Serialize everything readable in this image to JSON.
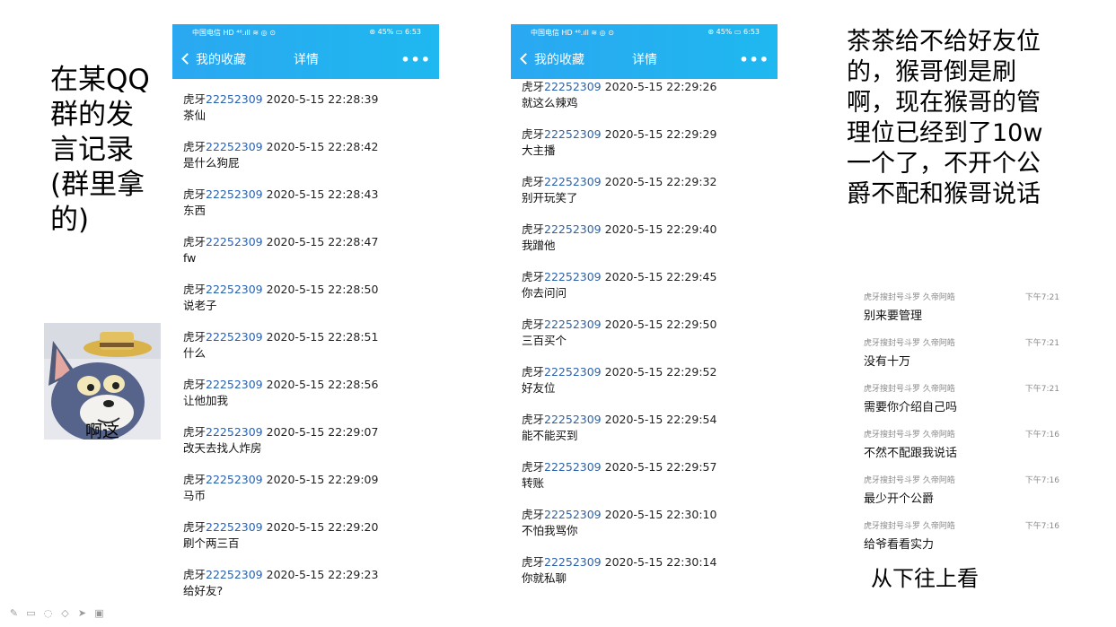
{
  "captions": {
    "left": "在某QQ群的发言记录(群里拿的)",
    "right": "茶茶给不给好友位的，猴哥倒是刷啊，现在猴哥的管理位已经到了10w一个了，不开个公爵不配和猴哥说话",
    "bottom": "从下往上看",
    "meme": "啊这"
  },
  "phones": [
    {
      "status_carrier": "中国电信 HD ⁴⁶.ıll ≋ ◎ ⊙",
      "status_right": "⊛ 45% ▭ 6:53",
      "back_label": "我的收藏",
      "title": "详情",
      "more": "•••",
      "messages": [
        {
          "name": "虎牙",
          "uid": "22252309",
          "time": "2020-5-15 22:28:39",
          "text": "茶仙"
        },
        {
          "name": "虎牙",
          "uid": "22252309",
          "time": "2020-5-15 22:28:42",
          "text": "是什么狗屁"
        },
        {
          "name": "虎牙",
          "uid": "22252309",
          "time": "2020-5-15 22:28:43",
          "text": "东西"
        },
        {
          "name": "虎牙",
          "uid": "22252309",
          "time": "2020-5-15 22:28:47",
          "text": "fw"
        },
        {
          "name": "虎牙",
          "uid": "22252309",
          "time": "2020-5-15 22:28:50",
          "text": "说老子"
        },
        {
          "name": "虎牙",
          "uid": "22252309",
          "time": "2020-5-15 22:28:51",
          "text": "什么"
        },
        {
          "name": "虎牙",
          "uid": "22252309",
          "time": "2020-5-15 22:28:56",
          "text": "让他加我"
        },
        {
          "name": "虎牙",
          "uid": "22252309",
          "time": "2020-5-15 22:29:07",
          "text": "改天去找人炸房"
        },
        {
          "name": "虎牙",
          "uid": "22252309",
          "time": "2020-5-15 22:29:09",
          "text": "马币"
        },
        {
          "name": "虎牙",
          "uid": "22252309",
          "time": "2020-5-15 22:29:20",
          "text": "刷个两三百"
        },
        {
          "name": "虎牙",
          "uid": "22252309",
          "time": "2020-5-15 22:29:23",
          "text": "给好友?"
        }
      ]
    },
    {
      "status_carrier": "中国电信 HD ⁴⁶.ıll ≋ ◎ ⊙",
      "status_right": "⊛ 45% ▭ 6:53",
      "back_label": "我的收藏",
      "title": "详情",
      "more": "•••",
      "messages": [
        {
          "name": "虎牙",
          "uid": "22252309",
          "time": "2020-5-15 22:29:26",
          "text": "就这么辣鸡"
        },
        {
          "name": "虎牙",
          "uid": "22252309",
          "time": "2020-5-15 22:29:29",
          "text": "大主播"
        },
        {
          "name": "虎牙",
          "uid": "22252309",
          "time": "2020-5-15 22:29:32",
          "text": "别开玩笑了"
        },
        {
          "name": "虎牙",
          "uid": "22252309",
          "time": "2020-5-15 22:29:40",
          "text": "我蹭他"
        },
        {
          "name": "虎牙",
          "uid": "22252309",
          "time": "2020-5-15 22:29:45",
          "text": "你去问问"
        },
        {
          "name": "虎牙",
          "uid": "22252309",
          "time": "2020-5-15 22:29:50",
          "text": "三百买个"
        },
        {
          "name": "虎牙",
          "uid": "22252309",
          "time": "2020-5-15 22:29:52",
          "text": "好友位"
        },
        {
          "name": "虎牙",
          "uid": "22252309",
          "time": "2020-5-15 22:29:54",
          "text": "能不能买到"
        },
        {
          "name": "虎牙",
          "uid": "22252309",
          "time": "2020-5-15 22:29:57",
          "text": "转账"
        },
        {
          "name": "虎牙",
          "uid": "22252309",
          "time": "2020-5-15 22:30:10",
          "text": "不怕我骂你"
        },
        {
          "name": "虎牙",
          "uid": "22252309",
          "time": "2020-5-15 22:30:14",
          "text": "你就私聊"
        }
      ]
    }
  ],
  "chat": [
    {
      "who": "虎牙搜封号斗罗 久帝阿皓",
      "time": "下午7:21",
      "text": "别来要管理"
    },
    {
      "who": "虎牙搜封号斗罗 久帝阿皓",
      "time": "下午7:21",
      "text": "没有十万"
    },
    {
      "who": "虎牙搜封号斗罗 久帝阿皓",
      "time": "下午7:21",
      "text": "需要你介绍自己吗"
    },
    {
      "who": "虎牙搜封号斗罗 久帝阿皓",
      "time": "下午7:16",
      "text": "不然不配跟我说话"
    },
    {
      "who": "虎牙搜封号斗罗 久帝阿皓",
      "time": "下午7:16",
      "text": "最少开个公爵"
    },
    {
      "who": "虎牙搜封号斗罗 久帝阿皓",
      "time": "下午7:16",
      "text": "给爷看看实力"
    }
  ],
  "toolbar_icons": [
    "pen-icon",
    "square-icon",
    "lasso-icon",
    "eraser-icon",
    "pointer-icon",
    "screen-icon"
  ],
  "colors": {
    "topbar": "#2aa8f1",
    "uid": "#2a62b0",
    "meta_gray": "#8a8a8a"
  }
}
